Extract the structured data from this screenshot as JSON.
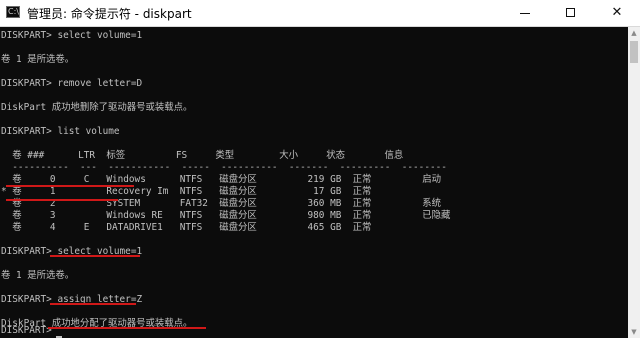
{
  "window": {
    "title": "管理员: 命令提示符 - diskpart",
    "icon_label": "C:\\",
    "controls": {
      "minimize": "minimize-icon",
      "maximize": "maximize-icon",
      "close": "✕"
    }
  },
  "console": {
    "lines": [
      "DISKPART> select volume=1",
      "",
      "卷 1 是所选卷。",
      "",
      "DISKPART> remove letter=D",
      "",
      "DiskPart 成功地删除了驱动器号或装载点。",
      "",
      "DISKPART> list volume",
      "",
      "  卷 ###      LTR  标签         FS     类型        大小     状态       信息",
      "  ----------  ---  -----------  -----  ----------  -------  ---------  --------",
      "  卷     0     C   Windows      NTFS   磁盘分区         219 GB  正常         启动",
      "* 卷     1         Recovery Im  NTFS   磁盘分区          17 GB  正常",
      "  卷     2         SYSTEM       FAT32  磁盘分区         360 MB  正常         系统",
      "  卷     3         Windows RE   NTFS   磁盘分区         980 MB  正常         已隐藏",
      "  卷     4     E   DATADRIVE1   NTFS   磁盘分区         465 GB  正常",
      "",
      "DISKPART> select volume=1",
      "",
      "卷 1 是所选卷。",
      "",
      "DISKPART> assign letter=Z",
      "",
      "DiskPart 成功地分配了驱动器号或装载点。",
      "",
      "DISKPART> "
    ]
  },
  "colors": {
    "console_bg": "#0c0c0c",
    "console_text": "#c0c0c0",
    "annotation": "#d01818"
  }
}
